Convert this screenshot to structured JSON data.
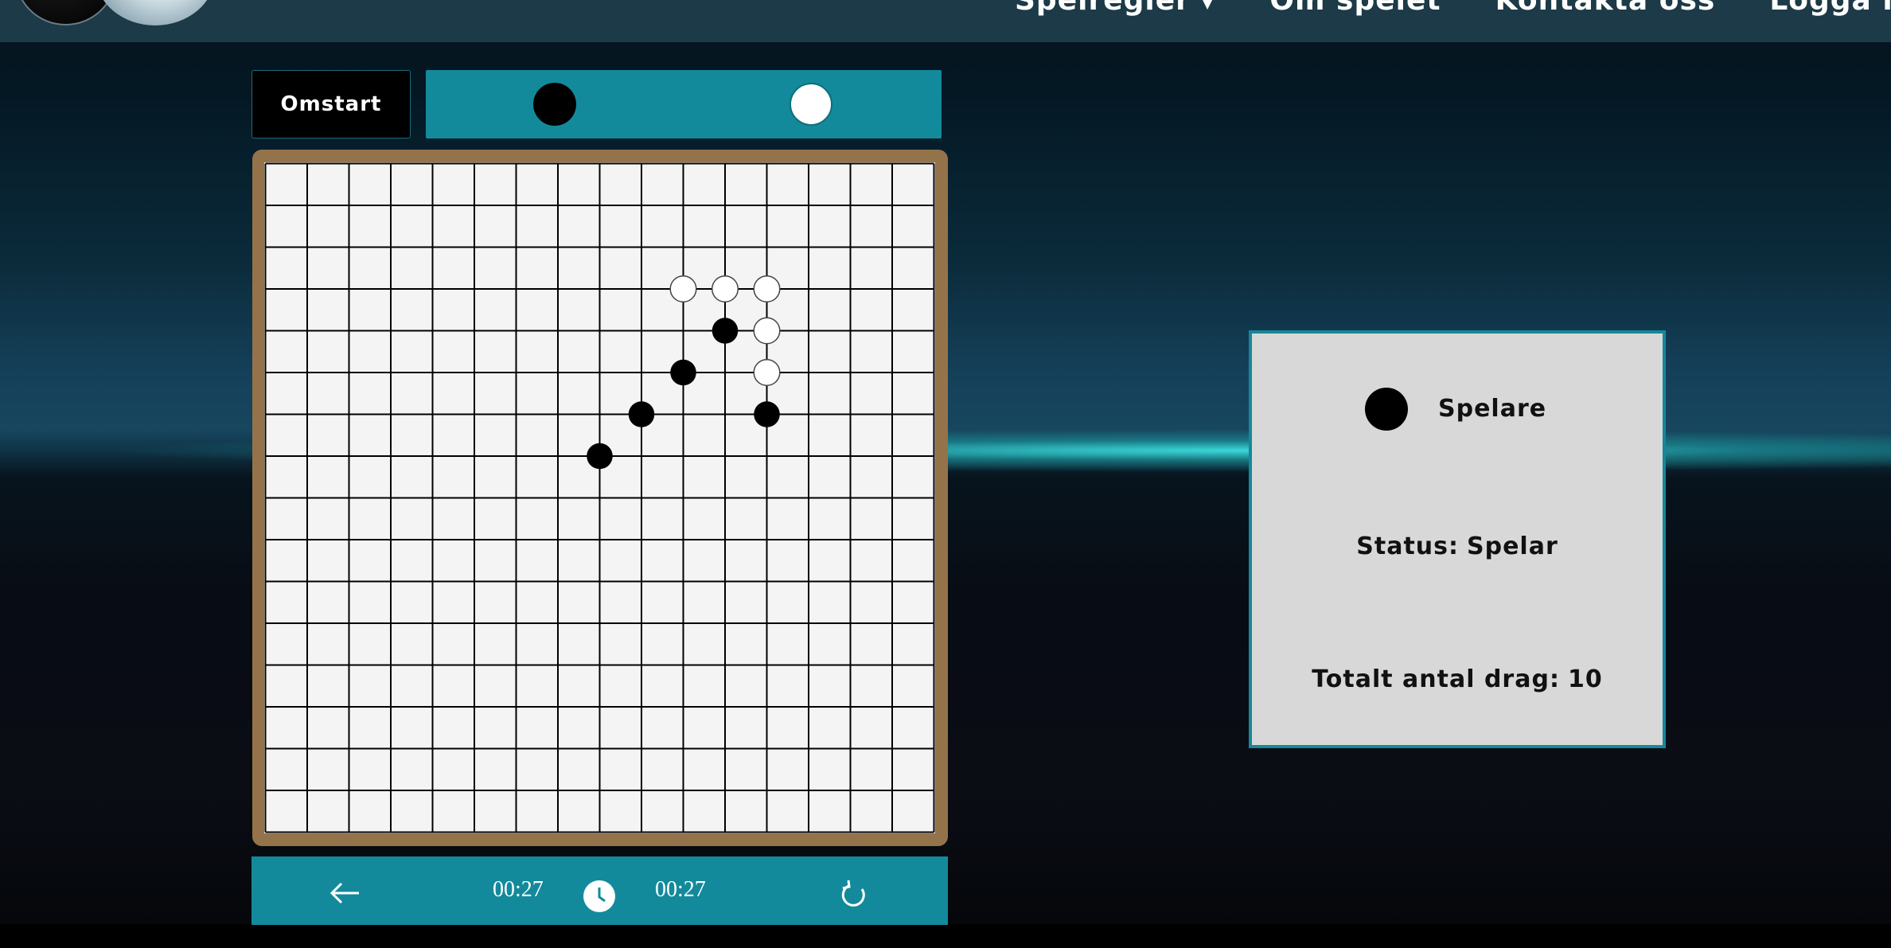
{
  "nav": {
    "items": [
      {
        "label": "Spelregler",
        "has_dropdown": true
      },
      {
        "label": "Om spelet",
        "has_dropdown": false
      },
      {
        "label": "Kontakta oss",
        "has_dropdown": false
      },
      {
        "label": "Logga in",
        "has_dropdown": false
      }
    ],
    "dropdown_icon": "chevron-down-icon"
  },
  "toolbar": {
    "restart_label": "Omstart"
  },
  "player_bar": {
    "players": [
      "black",
      "white"
    ]
  },
  "board": {
    "columns": 16,
    "rows": 16,
    "line_color": "#000000",
    "cell_color": "#f4f4f4",
    "frame_color": "#95734a",
    "stones": [
      {
        "color": "white",
        "col": 10,
        "row": 3
      },
      {
        "color": "white",
        "col": 11,
        "row": 3
      },
      {
        "color": "white",
        "col": 12,
        "row": 3
      },
      {
        "color": "black",
        "col": 11,
        "row": 4
      },
      {
        "color": "white",
        "col": 12,
        "row": 4
      },
      {
        "color": "black",
        "col": 10,
        "row": 5
      },
      {
        "color": "white",
        "col": 12,
        "row": 5
      },
      {
        "color": "black",
        "col": 9,
        "row": 6
      },
      {
        "color": "black",
        "col": 12,
        "row": 6
      },
      {
        "color": "black",
        "col": 8,
        "row": 7
      }
    ]
  },
  "controls": {
    "back_icon": "arrow-left-icon",
    "timer_black": "00:27",
    "clock_icon": "clock-icon",
    "timer_white": "00:27",
    "refresh_icon": "refresh-icon"
  },
  "status": {
    "current_player_color": "black",
    "player_label": "Spelare",
    "status_label": "Status:",
    "status_value": "Spelar",
    "moves_label": "Totalt antal drag:",
    "moves_value": "10"
  },
  "colors": {
    "accent": "#138a9b",
    "panel_bg": "#d8d8d8",
    "nav_bg": "#1c3a47"
  }
}
